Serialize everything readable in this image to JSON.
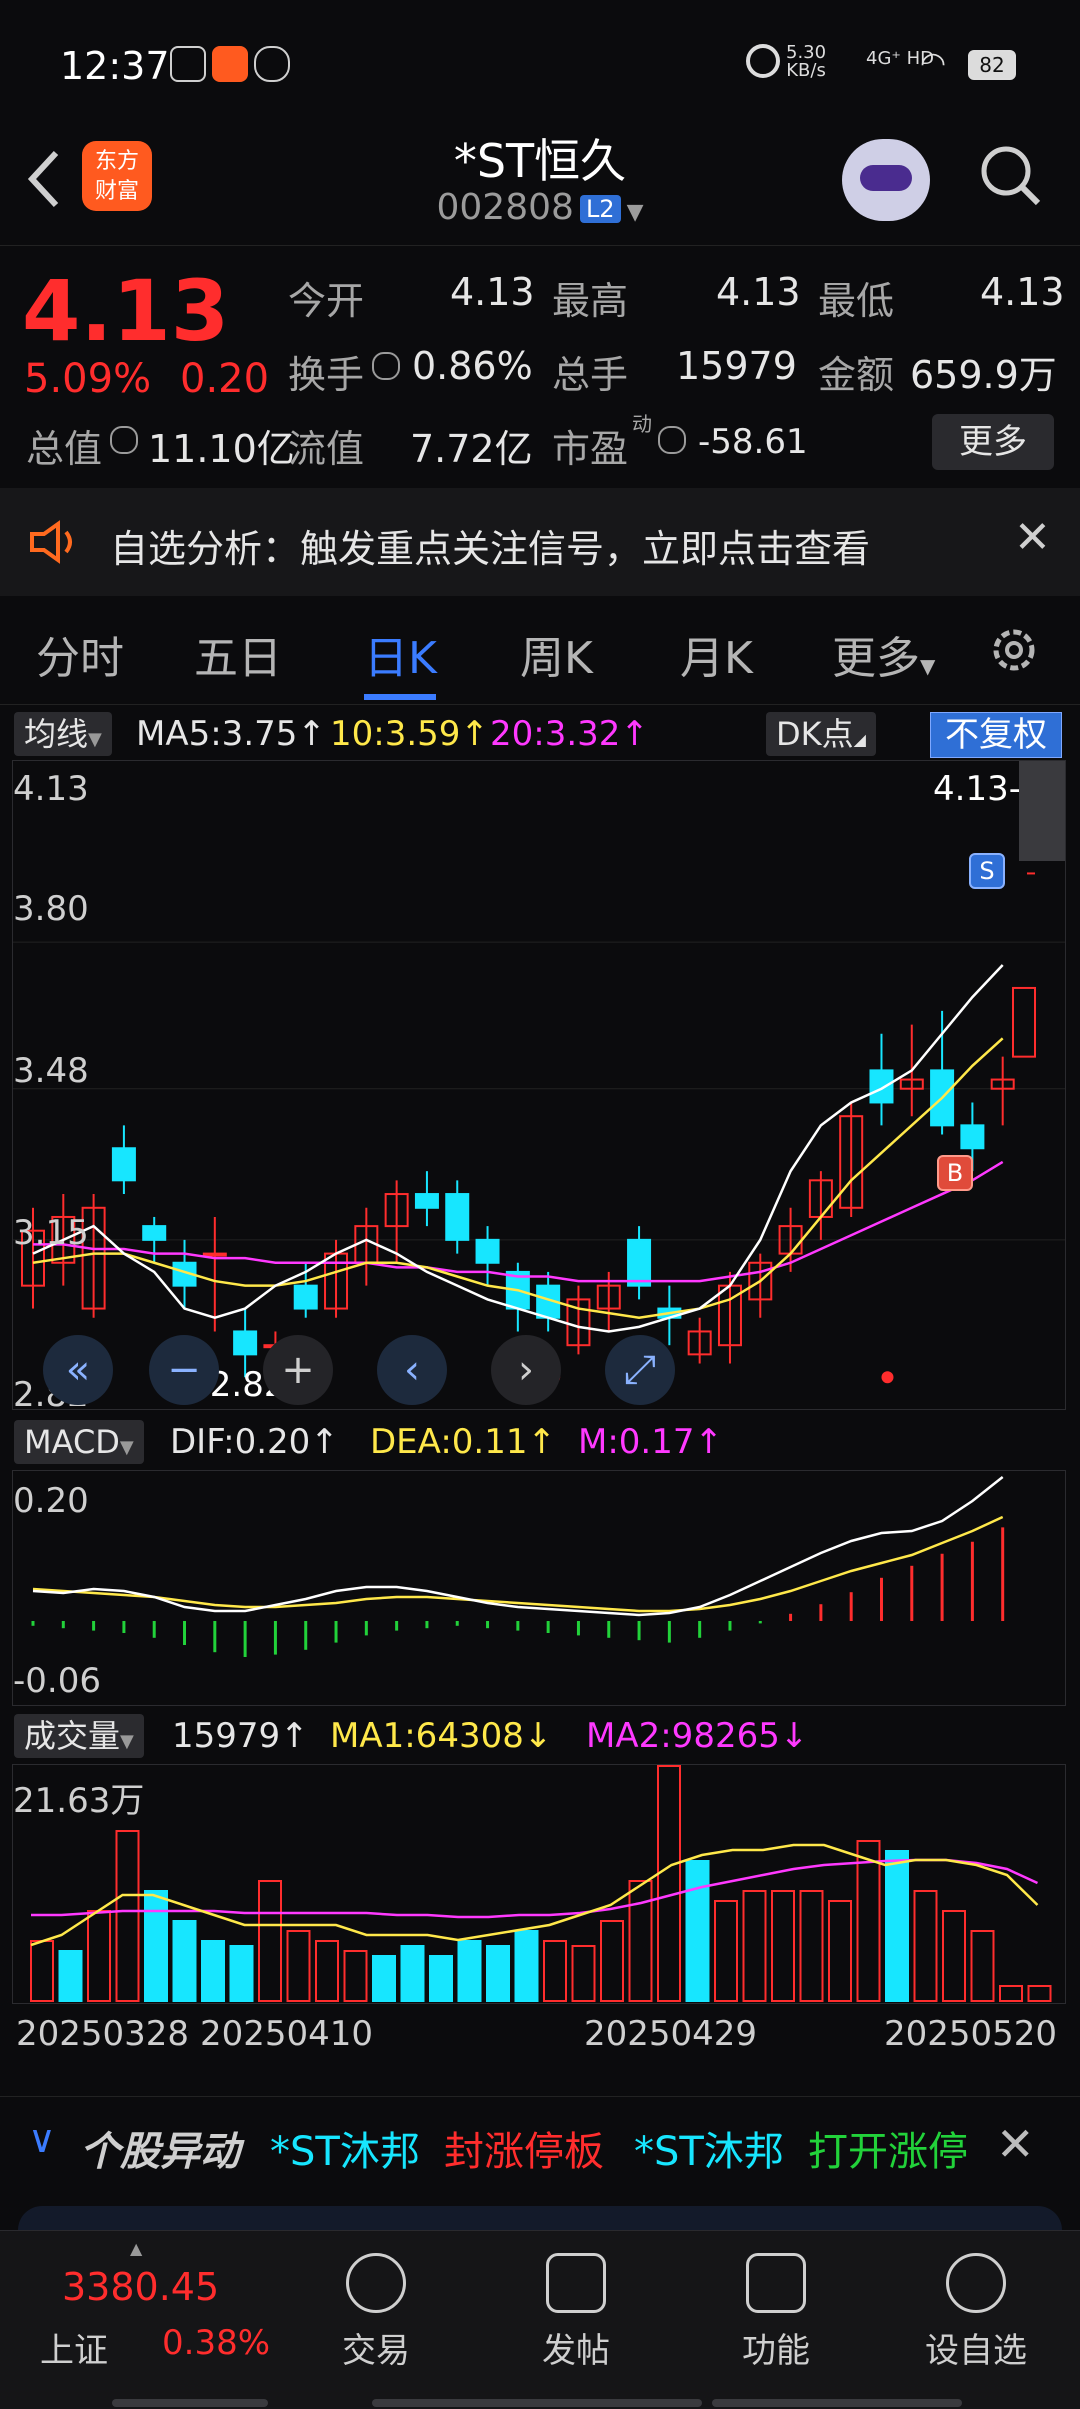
{
  "status_bar": {
    "time": "12:37",
    "net_speed": "5.30",
    "net_unit": "KB/s",
    "signal": "4G⁺ HD",
    "battery": "82"
  },
  "header": {
    "logo_text_line1": "东方",
    "logo_text_line2": "财富",
    "stock_name": "*ST恒久",
    "stock_code": "002808",
    "level_badge": "L2"
  },
  "quote": {
    "price": "4.13",
    "change_pct": "5.09%",
    "change": "0.20",
    "fields": [
      {
        "label": "今开",
        "value": "4.13",
        "color": "red"
      },
      {
        "label": "最高",
        "value": "4.13",
        "color": "red"
      },
      {
        "label": "最低",
        "value": "4.13",
        "color": "red"
      },
      {
        "label": "换手",
        "value": "0.86%",
        "color": "white"
      },
      {
        "label": "总手",
        "value": "15979",
        "color": "white"
      },
      {
        "label": "金额",
        "value": "659.9万",
        "color": "white"
      },
      {
        "label": "总值",
        "value": "11.10亿",
        "color": "white"
      },
      {
        "label": "流值",
        "value": "7.72亿",
        "color": "white"
      },
      {
        "label": "市盈",
        "value": "-58.61",
        "color": "white"
      }
    ],
    "pe_superscript": "动",
    "more_button": "更多"
  },
  "notice": {
    "text": "自选分析：触发重点关注信号，立即点击查看"
  },
  "tabs": [
    "分时",
    "五日",
    "日K",
    "周K",
    "月K",
    "更多"
  ],
  "ma_row": {
    "selector": "均线",
    "ma5": "MA5:3.75↑",
    "ma10": "10:3.59↑",
    "ma20": "20:3.32↑",
    "dk_label": "DK点",
    "adjust": "不复权"
  },
  "kline": {
    "top_label": "4.13",
    "right_label": "4.13->",
    "y_labels": [
      "3.80",
      "3.48",
      "3.15",
      "2.82"
    ],
    "min_label": "<-2.82",
    "sell_marker": "S",
    "buy_marker": "B"
  },
  "macd": {
    "selector": "MACD",
    "dif": "DIF:0.20↑",
    "dea": "DEA:0.11↑",
    "m": "M:0.17↑",
    "top_label": "0.20",
    "bottom_label": "-0.06"
  },
  "volume": {
    "selector": "成交量",
    "value": "15979↑",
    "ma1": "MA1:64308↓",
    "ma2": "MA2:98265↓",
    "top_label": "21.63万"
  },
  "dates": [
    "20250328",
    "20250410",
    "20250429",
    "20250520"
  ],
  "movement_bar": {
    "title": "个股异动",
    "items": [
      {
        "stock": "*ST沐邦",
        "event": "封涨停板"
      },
      {
        "stock": "*ST沐邦",
        "event": "打开涨停"
      }
    ]
  },
  "bottom_nav": {
    "index_value": "3380.45",
    "index_name": "上证",
    "index_pct": "0.38%",
    "items": [
      "交易",
      "发帖",
      "功能",
      "设自选"
    ]
  },
  "chart_data": {
    "type": "candlestick",
    "title": "",
    "ylim": [
      2.82,
      4.13
    ],
    "categories": [
      "20250328",
      "20250410",
      "20250429",
      "20250520"
    ],
    "series": [
      {
        "name": "MA5",
        "values": [
          3.75
        ]
      },
      {
        "name": "10",
        "values": [
          3.59
        ]
      },
      {
        "name": "20",
        "values": [
          3.32
        ]
      }
    ],
    "volume_last": 15979,
    "volume_ma1": 64308,
    "volume_ma2": 98265,
    "macd_dif": 0.2,
    "macd_dea": 0.11,
    "macd_m": 0.17
  }
}
